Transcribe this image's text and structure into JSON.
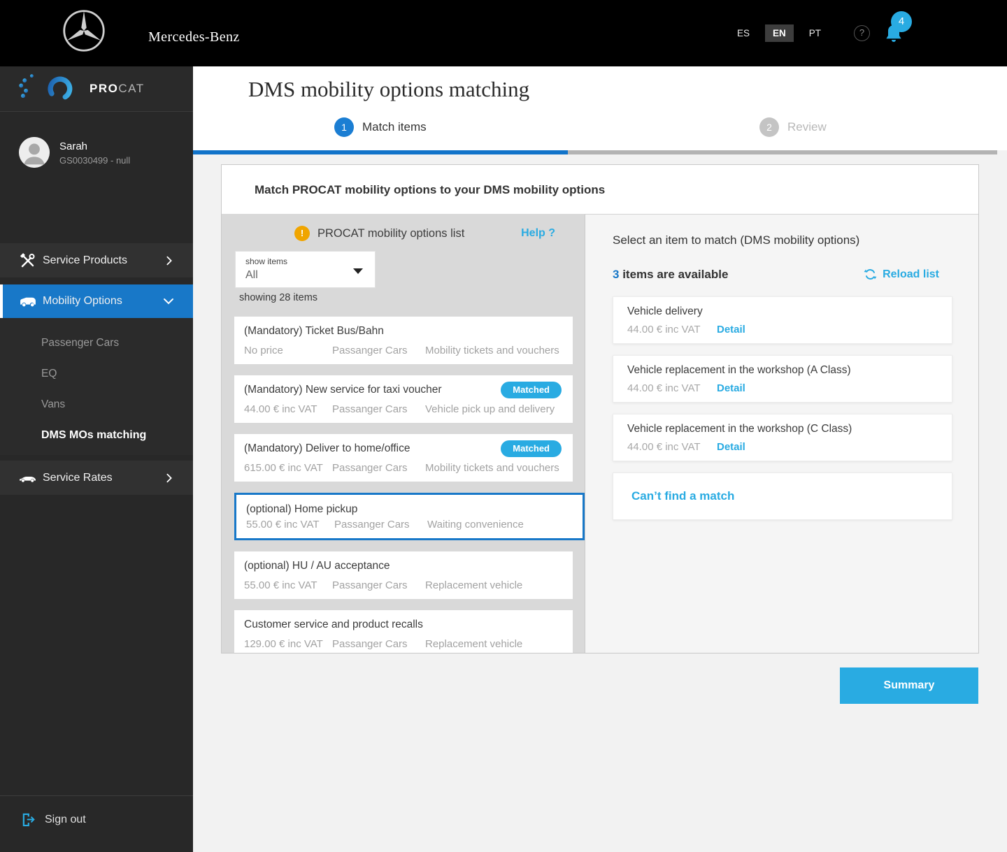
{
  "header": {
    "brand": "Mercedes-Benz",
    "languages": [
      "ES",
      "EN",
      "PT"
    ],
    "active_language": "EN",
    "help_glyph": "?",
    "notification_count": "4"
  },
  "sidebar": {
    "logo_pro": "PRO",
    "logo_cat": "CAT",
    "user": {
      "name": "Sarah",
      "id": "GS0030499 - null"
    },
    "nav": [
      {
        "label": "Service Products"
      },
      {
        "label": "Mobility Options"
      },
      {
        "label": "Service Rates"
      }
    ],
    "submenu": [
      "Passenger Cars",
      "EQ",
      "Vans",
      "DMS MOs matching"
    ],
    "sign_out": "Sign out"
  },
  "page": {
    "title": "DMS mobility options matching",
    "steps": [
      {
        "num": "1",
        "label": "Match items"
      },
      {
        "num": "2",
        "label": "Review"
      }
    ],
    "card_title": "Match PROCAT mobility options to your DMS mobility options"
  },
  "left_panel": {
    "warning_glyph": "!",
    "title": "PROCAT mobility options list",
    "help": "Help ?",
    "filter_label": "show items",
    "filter_value": "All",
    "showing": "showing 28 items",
    "matched_label": "Matched",
    "items": [
      {
        "title": "(Mandatory) Ticket Bus/Bahn",
        "price": "No price",
        "category": "Passanger Cars",
        "type": "Mobility tickets and vouchers"
      },
      {
        "title": "(Mandatory) New service for taxi voucher",
        "price": "44.00 € inc VAT",
        "category": "Passanger Cars",
        "type": "Vehicle pick up and delivery"
      },
      {
        "title": "(Mandatory) Deliver to home/office",
        "price": "615.00 € inc VAT",
        "category": "Passanger Cars",
        "type": "Mobility tickets and vouchers"
      },
      {
        "title": "(optional) Home pickup",
        "price": "55.00 € inc VAT",
        "category": "Passanger Cars",
        "type": "Waiting convenience"
      },
      {
        "title": "(optional) HU / AU acceptance",
        "price": "55.00 € inc VAT",
        "category": "Passanger Cars",
        "type": "Replacement vehicle"
      },
      {
        "title": "Customer service and product recalls",
        "price": "129.00 € inc VAT",
        "category": "Passanger Cars",
        "type": "Replacement vehicle"
      }
    ]
  },
  "right_panel": {
    "title": "Select an item to match (DMS mobility options)",
    "count": "3",
    "count_suffix": " items are available",
    "reload": "Reload list",
    "detail_label": "Detail",
    "items": [
      {
        "title": "Vehicle delivery",
        "price": "44.00 € inc VAT"
      },
      {
        "title": "Vehicle replacement in the workshop (A Class)",
        "price": "44.00 € inc VAT"
      },
      {
        "title": "Vehicle replacement in the workshop (C Class)",
        "price": "44.00 € inc VAT"
      }
    ],
    "no_match": "Can’t find a match"
  },
  "summary_button": "Summary",
  "colors": {
    "accent": "#29abe2",
    "primary_blue": "#1878c8",
    "warning": "#f0a500",
    "step_inactive": "#c4c4c4"
  }
}
